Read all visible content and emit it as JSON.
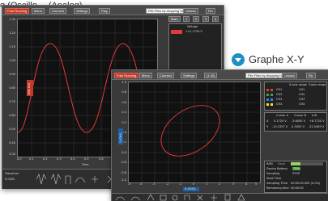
{
  "caption": {
    "left_text": "g (Oscillo… (Analog)",
    "right_text": "Graphe X-Y",
    "icon_color": "#1f8fc4"
  },
  "win1": {
    "toolbar": {
      "menu1": "Free Running",
      "menu2": "Menu",
      "btn1": "Connect",
      "btn2": "Settings",
      "btn3": "Play",
      "drop_zone": "Pile Files by dropping here",
      "btn4": "Unload",
      "btn5": "Fin"
    },
    "channel_label": "CH1 Ch1",
    "x_axis_label": "Time",
    "y_ticks": [
      "1.30",
      "1.20",
      "1.10",
      "1.00",
      "0.90",
      "0.80",
      "0.70",
      "0.60",
      "0.50",
      "0.40",
      "0.30"
    ],
    "x_ticks": [
      "0.0",
      "0.1",
      "0.2",
      "0.3",
      "0.4",
      "0.5",
      "0.6",
      "0.7",
      "0.8",
      "0.9",
      "1.0"
    ],
    "side": {
      "tab_label": "Main",
      "tabs": [
        "1",
        "2",
        "3",
        "4"
      ],
      "header": "Voltage",
      "value": "+11.7720 V"
    },
    "bottom": {
      "label1": "Transform",
      "label2": "0.0005"
    }
  },
  "win2": {
    "toolbar": {
      "menu1": "Free Running",
      "menu2": "Menu",
      "btn1": "Connect",
      "btn2": "Settings",
      "btn3": "(1.00)",
      "drop_zone": "Pile Files by dropping here",
      "btn4": "Unload",
      "btn5": "Fin"
    },
    "y_axis_label": "Y (CH1)",
    "x_axis_label": "X (CH1)",
    "y_ticks": [
      "1.0",
      "0.8",
      "0.6",
      "0.4",
      "0.2",
      "0.0",
      "-0.2",
      "-0.4",
      "-0.6",
      "-0.8",
      "-1.0"
    ],
    "x_ticks": [
      "-5",
      "-4",
      "-3",
      "-2",
      "-1",
      "0",
      "1",
      "2",
      "3",
      "4",
      "5"
    ],
    "side": {
      "header_a": "X-axis range",
      "header_b": "Y-axis range",
      "rows": [
        {
          "label": "CH1",
          "val": "CH1",
          "color": "#e53935"
        },
        {
          "label": "CH2",
          "val": "CH2",
          "color": "#43a047"
        },
        {
          "label": "CH3",
          "val": "CH3",
          "color": "#1e88e5"
        },
        {
          "label": "CH4",
          "val": "CH4",
          "color": "#fdd835"
        }
      ],
      "cursor_head": [
        "",
        "Cursor A",
        "Cursor B",
        "A-B"
      ],
      "cursor_rows": [
        [
          "X",
          "5.1720 V",
          "-3.6000 V",
          "+8.7720 V"
        ],
        [
          "Y",
          "-14.2357 V",
          "-4.5000 V",
          "-22.0465 V"
        ]
      ],
      "status": [
        {
          "k": "RAM",
          "v": "Used"
        },
        {
          "k": "Device Battery",
          "v": "70%"
        },
        {
          "k": "Sampling",
          "v": "STOP"
        },
        {
          "k": "Start Time",
          "v": ""
        },
        {
          "k": "Sampling Time",
          "v": "00:00:00.000 (0.0%)"
        },
        {
          "k": "Remaining time",
          "v": "00:00:00"
        }
      ]
    }
  }
}
